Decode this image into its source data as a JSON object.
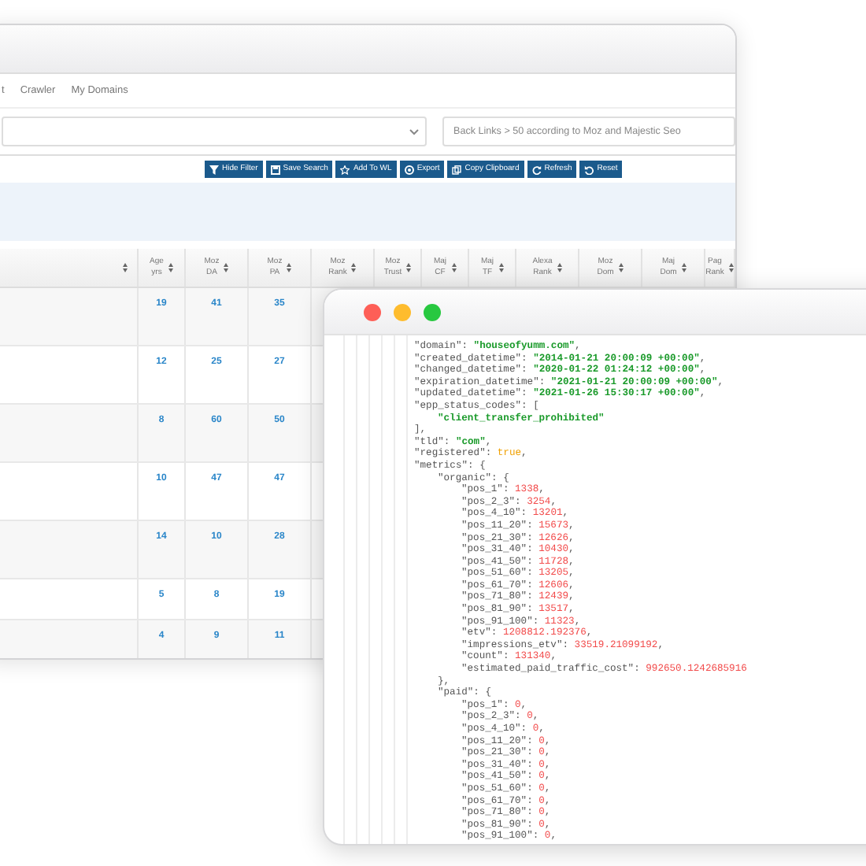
{
  "nav": [
    "t",
    "Crawler",
    "My Domains"
  ],
  "filter": {
    "search": {
      "placeholder": "Back Links > 50 according to Moz and Majestic Seo"
    }
  },
  "toolbar": [
    "Hide Filter",
    "Save Search",
    "Add To WL",
    "Export",
    "Copy Clipboard",
    "Refresh",
    "Reset"
  ],
  "table": {
    "columns": [
      {
        "lines": [
          "Age",
          "yrs"
        ]
      },
      {
        "lines": [
          "Moz",
          "DA"
        ]
      },
      {
        "lines": [
          "Moz",
          "PA"
        ]
      },
      {
        "lines": [
          "Moz",
          "Rank"
        ]
      },
      {
        "lines": [
          "Moz",
          "Trust"
        ]
      },
      {
        "lines": [
          "Maj",
          "CF"
        ]
      },
      {
        "lines": [
          "Maj",
          "TF"
        ]
      },
      {
        "lines": [
          "Alexa",
          "Rank"
        ]
      },
      {
        "lines": [
          "Moz",
          "Dom"
        ]
      },
      {
        "lines": [
          "Maj",
          "Dom"
        ]
      },
      {
        "lines": [
          "Pag",
          "Rank"
        ]
      }
    ],
    "rows": [
      {
        "cells": [
          "19",
          "41",
          "35"
        ]
      },
      {
        "cells": [
          "12",
          "25",
          "27"
        ]
      },
      {
        "cells": [
          "8",
          "60",
          "50"
        ]
      },
      {
        "cells": [
          "10",
          "47",
          "47"
        ]
      },
      {
        "cells": [
          "14",
          "10",
          "28"
        ]
      },
      {
        "cells": [
          "5",
          "8",
          "19"
        ]
      },
      {
        "cells": [
          "4",
          "9",
          "11"
        ]
      }
    ]
  },
  "code": [
    {
      "parts": [
        {
          "kind": "key",
          "text": "\"domain\": "
        },
        {
          "kind": "string",
          "text": "\"houseofyumm.com\""
        },
        {
          "kind": "punct",
          "text": ","
        }
      ]
    },
    {
      "parts": [
        {
          "kind": "key",
          "text": "\"created_datetime\": "
        },
        {
          "kind": "string",
          "text": "\"2014-01-21 20:00:09 +00:00\""
        },
        {
          "kind": "punct",
          "text": ","
        }
      ]
    },
    {
      "parts": [
        {
          "kind": "key",
          "text": "\"changed_datetime\": "
        },
        {
          "kind": "string",
          "text": "\"2020-01-22 01:24:12 +00:00\""
        },
        {
          "kind": "punct",
          "text": ","
        }
      ]
    },
    {
      "parts": [
        {
          "kind": "key",
          "text": "\"expiration_datetime\": "
        },
        {
          "kind": "string",
          "text": "\"2021-01-21 20:00:09 +00:00\""
        },
        {
          "kind": "punct",
          "text": ","
        }
      ]
    },
    {
      "parts": [
        {
          "kind": "key",
          "text": "\"updated_datetime\": "
        },
        {
          "kind": "string",
          "text": "\"2021-01-26 15:30:17 +00:00\""
        },
        {
          "kind": "punct",
          "text": ","
        }
      ]
    },
    {
      "parts": [
        {
          "kind": "key",
          "text": "\"epp_status_codes\": ["
        }
      ],
      "children": [
        {
          "parts": [
            {
              "kind": "string",
              "text": "\"client_transfer_prohibited\""
            }
          ]
        }
      ]
    },
    {
      "parts": [
        {
          "kind": "punct",
          "text": "],"
        }
      ]
    },
    {
      "parts": [
        {
          "kind": "key",
          "text": "\"tld\": "
        },
        {
          "kind": "string",
          "text": "\"com\""
        },
        {
          "kind": "punct",
          "text": ","
        }
      ]
    },
    {
      "parts": [
        {
          "kind": "key",
          "text": "\"registered\": "
        },
        {
          "kind": "bool",
          "text": "true"
        },
        {
          "kind": "punct",
          "text": ","
        }
      ]
    },
    {
      "parts": [
        {
          "kind": "key",
          "text": "\"metrics\": {"
        }
      ],
      "children": [
        {
          "parts": [
            {
              "kind": "key",
              "text": "\"organic\": {"
            }
          ],
          "children": [
            {
              "parts": [
                {
                  "kind": "key",
                  "text": "\"pos_1\": "
                },
                {
                  "kind": "number",
                  "text": "1338"
                },
                {
                  "kind": "punct",
                  "text": ","
                }
              ]
            },
            {
              "parts": [
                {
                  "kind": "key",
                  "text": "\"pos_2_3\": "
                },
                {
                  "kind": "number",
                  "text": "3254"
                },
                {
                  "kind": "punct",
                  "text": ","
                }
              ]
            },
            {
              "parts": [
                {
                  "kind": "key",
                  "text": "\"pos_4_10\": "
                },
                {
                  "kind": "number",
                  "text": "13201"
                },
                {
                  "kind": "punct",
                  "text": ","
                }
              ]
            },
            {
              "parts": [
                {
                  "kind": "key",
                  "text": "\"pos_11_20\": "
                },
                {
                  "kind": "number",
                  "text": "15673"
                },
                {
                  "kind": "punct",
                  "text": ","
                }
              ]
            },
            {
              "parts": [
                {
                  "kind": "key",
                  "text": "\"pos_21_30\": "
                },
                {
                  "kind": "number",
                  "text": "12626"
                },
                {
                  "kind": "punct",
                  "text": ","
                }
              ]
            },
            {
              "parts": [
                {
                  "kind": "key",
                  "text": "\"pos_31_40\": "
                },
                {
                  "kind": "number",
                  "text": "10430"
                },
                {
                  "kind": "punct",
                  "text": ","
                }
              ]
            },
            {
              "parts": [
                {
                  "kind": "key",
                  "text": "\"pos_41_50\": "
                },
                {
                  "kind": "number",
                  "text": "11728"
                },
                {
                  "kind": "punct",
                  "text": ","
                }
              ]
            },
            {
              "parts": [
                {
                  "kind": "key",
                  "text": "\"pos_51_60\": "
                },
                {
                  "kind": "number",
                  "text": "13205"
                },
                {
                  "kind": "punct",
                  "text": ","
                }
              ]
            },
            {
              "parts": [
                {
                  "kind": "key",
                  "text": "\"pos_61_70\": "
                },
                {
                  "kind": "number",
                  "text": "12606"
                },
                {
                  "kind": "punct",
                  "text": ","
                }
              ]
            },
            {
              "parts": [
                {
                  "kind": "key",
                  "text": "\"pos_71_80\": "
                },
                {
                  "kind": "number",
                  "text": "12439"
                },
                {
                  "kind": "punct",
                  "text": ","
                }
              ]
            },
            {
              "parts": [
                {
                  "kind": "key",
                  "text": "\"pos_81_90\": "
                },
                {
                  "kind": "number",
                  "text": "13517"
                },
                {
                  "kind": "punct",
                  "text": ","
                }
              ]
            },
            {
              "parts": [
                {
                  "kind": "key",
                  "text": "\"pos_91_100\": "
                },
                {
                  "kind": "number",
                  "text": "11323"
                },
                {
                  "kind": "punct",
                  "text": ","
                }
              ]
            },
            {
              "parts": [
                {
                  "kind": "key",
                  "text": "\"etv\": "
                },
                {
                  "kind": "number",
                  "text": "1208812.192376"
                },
                {
                  "kind": "punct",
                  "text": ","
                }
              ]
            },
            {
              "parts": [
                {
                  "kind": "key",
                  "text": "\"impressions_etv\": "
                },
                {
                  "kind": "number",
                  "text": "33519.21099192"
                },
                {
                  "kind": "punct",
                  "text": ","
                }
              ]
            },
            {
              "parts": [
                {
                  "kind": "key",
                  "text": "\"count\": "
                },
                {
                  "kind": "number",
                  "text": "131340"
                },
                {
                  "kind": "punct",
                  "text": ","
                }
              ]
            },
            {
              "parts": [
                {
                  "kind": "key",
                  "text": "\"estimated_paid_traffic_cost\": "
                },
                {
                  "kind": "number",
                  "text": "992650.1242685916"
                }
              ]
            }
          ]
        },
        {
          "parts": [
            {
              "kind": "punct",
              "text": "},"
            }
          ]
        },
        {
          "parts": [
            {
              "kind": "key",
              "text": "\"paid\": {"
            }
          ],
          "children": [
            {
              "parts": [
                {
                  "kind": "key",
                  "text": "\"pos_1\": "
                },
                {
                  "kind": "number",
                  "text": "0"
                },
                {
                  "kind": "punct",
                  "text": ","
                }
              ]
            },
            {
              "parts": [
                {
                  "kind": "key",
                  "text": "\"pos_2_3\": "
                },
                {
                  "kind": "number",
                  "text": "0"
                },
                {
                  "kind": "punct",
                  "text": ","
                }
              ]
            },
            {
              "parts": [
                {
                  "kind": "key",
                  "text": "\"pos_4_10\": "
                },
                {
                  "kind": "number",
                  "text": "0"
                },
                {
                  "kind": "punct",
                  "text": ","
                }
              ]
            },
            {
              "parts": [
                {
                  "kind": "key",
                  "text": "\"pos_11_20\": "
                },
                {
                  "kind": "number",
                  "text": "0"
                },
                {
                  "kind": "punct",
                  "text": ","
                }
              ]
            },
            {
              "parts": [
                {
                  "kind": "key",
                  "text": "\"pos_21_30\": "
                },
                {
                  "kind": "number",
                  "text": "0"
                },
                {
                  "kind": "punct",
                  "text": ","
                }
              ]
            },
            {
              "parts": [
                {
                  "kind": "key",
                  "text": "\"pos_31_40\": "
                },
                {
                  "kind": "number",
                  "text": "0"
                },
                {
                  "kind": "punct",
                  "text": ","
                }
              ]
            },
            {
              "parts": [
                {
                  "kind": "key",
                  "text": "\"pos_41_50\": "
                },
                {
                  "kind": "number",
                  "text": "0"
                },
                {
                  "kind": "punct",
                  "text": ","
                }
              ]
            },
            {
              "parts": [
                {
                  "kind": "key",
                  "text": "\"pos_51_60\": "
                },
                {
                  "kind": "number",
                  "text": "0"
                },
                {
                  "kind": "punct",
                  "text": ","
                }
              ]
            },
            {
              "parts": [
                {
                  "kind": "key",
                  "text": "\"pos_61_70\": "
                },
                {
                  "kind": "number",
                  "text": "0"
                },
                {
                  "kind": "punct",
                  "text": ","
                }
              ]
            },
            {
              "parts": [
                {
                  "kind": "key",
                  "text": "\"pos_71_80\": "
                },
                {
                  "kind": "number",
                  "text": "0"
                },
                {
                  "kind": "punct",
                  "text": ","
                }
              ]
            },
            {
              "parts": [
                {
                  "kind": "key",
                  "text": "\"pos_81_90\": "
                },
                {
                  "kind": "number",
                  "text": "0"
                },
                {
                  "kind": "punct",
                  "text": ","
                }
              ]
            },
            {
              "parts": [
                {
                  "kind": "key",
                  "text": "\"pos_91_100\": "
                },
                {
                  "kind": "number",
                  "text": "0"
                },
                {
                  "kind": "punct",
                  "text": ","
                }
              ]
            }
          ]
        }
      ]
    }
  ]
}
